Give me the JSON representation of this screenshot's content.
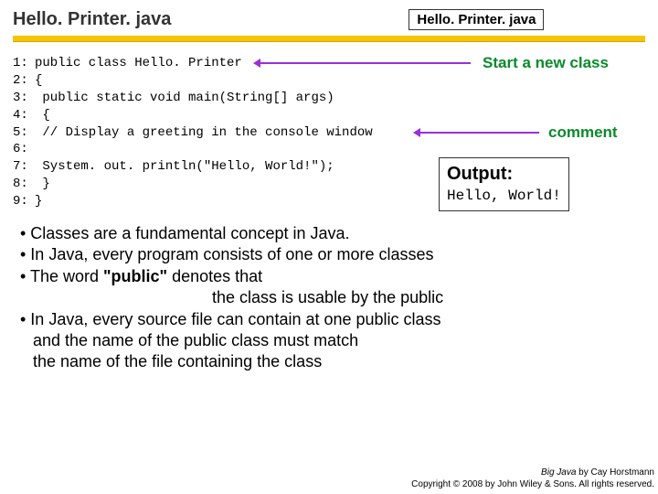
{
  "header": {
    "title_left": "Hello. Printer. java",
    "title_right": "Hello. Printer. java"
  },
  "code": {
    "lines": [
      "public class Hello. Printer",
      "{",
      "    public static void main(String[] args)",
      "    {",
      "        // Display a greeting in the console window",
      "",
      "        System. out. println(\"Hello, World!\");",
      "    }",
      "}"
    ],
    "line_numbers": [
      "1:",
      "2:",
      "3:",
      "4:",
      "5:",
      "6:",
      "7:",
      "8:",
      "9:"
    ]
  },
  "annotations": {
    "start_class": "Start a new class",
    "comment": "comment",
    "output_title": "Output:",
    "output_text": "Hello, World!"
  },
  "bullets": {
    "b1": "• Classes are a fundamental concept in Java.",
    "b2": "• In Java, every program consists of one or more classes",
    "b3a": "• The word ",
    "b3q": "\"public\"",
    "b3b": " denotes that",
    "b3c": "the class is usable by the public",
    "b4a": "• In Java, every source file can contain at one public class",
    "b4b": "and the name of the public class must match",
    "b4c": "the name of the file containing the class"
  },
  "footer": {
    "line1a": "Big Java",
    "line1b": " by Cay Horstmann",
    "line2": "Copyright © 2008 by John Wiley & Sons. All rights reserved."
  }
}
